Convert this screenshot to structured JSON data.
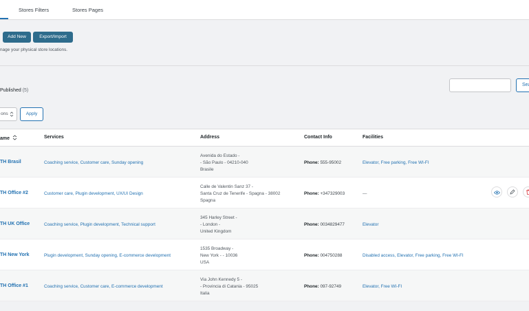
{
  "tabs": [
    {
      "label": "Stores Filters"
    },
    {
      "label": "Stores Pages"
    }
  ],
  "toolbar": {
    "add_new_label": "Add New",
    "export_import_label": "Export/Import"
  },
  "description": "nage your physical store locations.",
  "filters": {
    "status_label": "Published",
    "status_count": "(5)"
  },
  "search": {
    "placeholder": "",
    "button_label": "Sea"
  },
  "bulk_actions": {
    "selected": "ons",
    "apply_label": "Apply"
  },
  "table": {
    "headers": {
      "name": "ame",
      "services": "Services",
      "address": "Address",
      "contact": "Contact Info",
      "facilities": "Facilities"
    },
    "rows": [
      {
        "name": "TH Brasil",
        "services": "Coaching service, Customer care, Sunday opening",
        "address_lines": [
          "Avenida do Estado -",
          "- São Paulo - 04210-040",
          "Brasile"
        ],
        "phone_label": "Phone:",
        "phone": "555-95002",
        "facilities": "Elevator, Free parking, Free WI-FI"
      },
      {
        "name": "TH Office #2",
        "services": "Customer care, Plugin development, UX/UI Design",
        "address_lines": [
          "Calle de Valentin Sanz 37 -",
          "Santa Cruz de Tenerife - Spagna - 38002",
          "Spagna"
        ],
        "phone_label": "Phone:",
        "phone": "+347329003",
        "facilities": "—"
      },
      {
        "name": "TH UK Office",
        "services": "Coaching service, Plugin development, Technical support",
        "address_lines": [
          "345 Harley Street -",
          "- London -",
          "United Kingdom"
        ],
        "phone_label": "Phone:",
        "phone": "0034829477",
        "facilities": "Elevator"
      },
      {
        "name": "TH New York",
        "services": "Plugin development, Sunday opening, E-commerce development",
        "address_lines": [
          "1535 Broadway -",
          "New York - - 10036",
          "USA"
        ],
        "phone_label": "Phone:",
        "phone": "004750288",
        "facilities": "Disabled access, Elevator, Free parking, Free WI-FI"
      },
      {
        "name": "TH Office #1",
        "services": "Coaching service, Customer care, E-commerce development",
        "address_lines": [
          "Via John Kennedy 5 -",
          "- Provincia di Catania - 95025",
          "Italia"
        ],
        "phone_label": "Phone:",
        "phone": "097-92749",
        "facilities": "Elevator, Free WI-FI"
      }
    ],
    "row_actions": {
      "icons": [
        "eye-icon",
        "pencil-icon",
        "trash-icon"
      ]
    }
  },
  "colors": {
    "accent": "#2271b1",
    "primary_button": "#2e6c8c",
    "danger": "#d63638"
  }
}
